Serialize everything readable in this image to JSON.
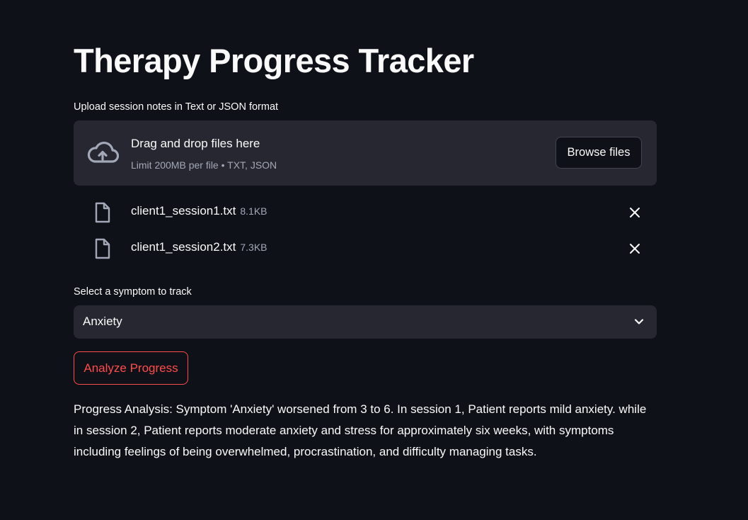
{
  "page": {
    "title": "Therapy Progress Tracker"
  },
  "uploader": {
    "label": "Upload session notes in Text or JSON format",
    "drop_text": "Drag and drop files here",
    "limit_text": "Limit 200MB per file • TXT, JSON",
    "browse_label": "Browse files",
    "icon": "cloud-upload-icon"
  },
  "files": [
    {
      "name": "client1_session1.txt",
      "size": "8.1KB"
    },
    {
      "name": "client1_session2.txt",
      "size": "7.3KB"
    }
  ],
  "symptom_select": {
    "label": "Select a symptom to track",
    "value": "Anxiety"
  },
  "analyze_button": {
    "label": "Analyze Progress"
  },
  "result": {
    "text": "Progress Analysis: Symptom 'Anxiety' worsened from 3 to 6. In session 1, Patient reports mild anxiety. while in session 2, Patient reports moderate anxiety and stress for approximately six weeks, with symptoms including feelings of being overwhelmed, procrastination, and difficulty managing tasks."
  },
  "colors": {
    "background": "#0e1117",
    "surface": "#262730",
    "accent": "#ff4b4b",
    "text": "#fafafa",
    "muted": "#a3a8b8"
  }
}
